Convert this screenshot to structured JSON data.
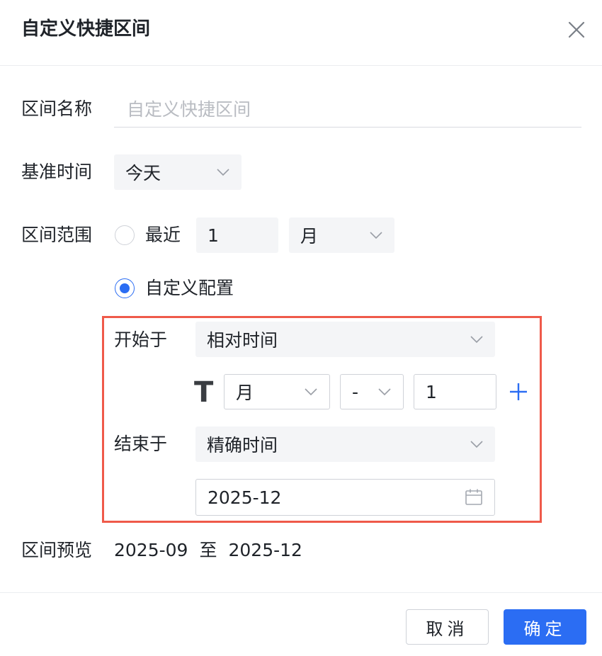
{
  "dialog": {
    "title": "自定义快捷区间",
    "close_icon": "close-icon"
  },
  "form": {
    "name_label": "区间名称",
    "name_placeholder": "自定义快捷区间",
    "name_value": "",
    "base_label": "基准时间",
    "base_value": "今天",
    "range_label": "区间范围",
    "recent_label": "最近",
    "recent_count": "1",
    "recent_unit": "月",
    "custom_label": "自定义配置",
    "selected_option": "自定义配置",
    "start_label": "开始于",
    "start_type": "相对时间",
    "relative_symbol": "T",
    "relative_unit": "月",
    "relative_op": "-",
    "relative_value": "1",
    "end_label": "结束于",
    "end_type": "精确时间",
    "end_date": "2025-12",
    "preview_label": "区间预览",
    "preview_start": "2025-09",
    "preview_to": "至",
    "preview_end": "2025-12"
  },
  "footer": {
    "cancel_label": "取消",
    "ok_label": "确定"
  },
  "colors": {
    "accent": "#2b6df3",
    "highlight_border": "#ef5a4a",
    "field_bg": "#f4f5f7"
  }
}
